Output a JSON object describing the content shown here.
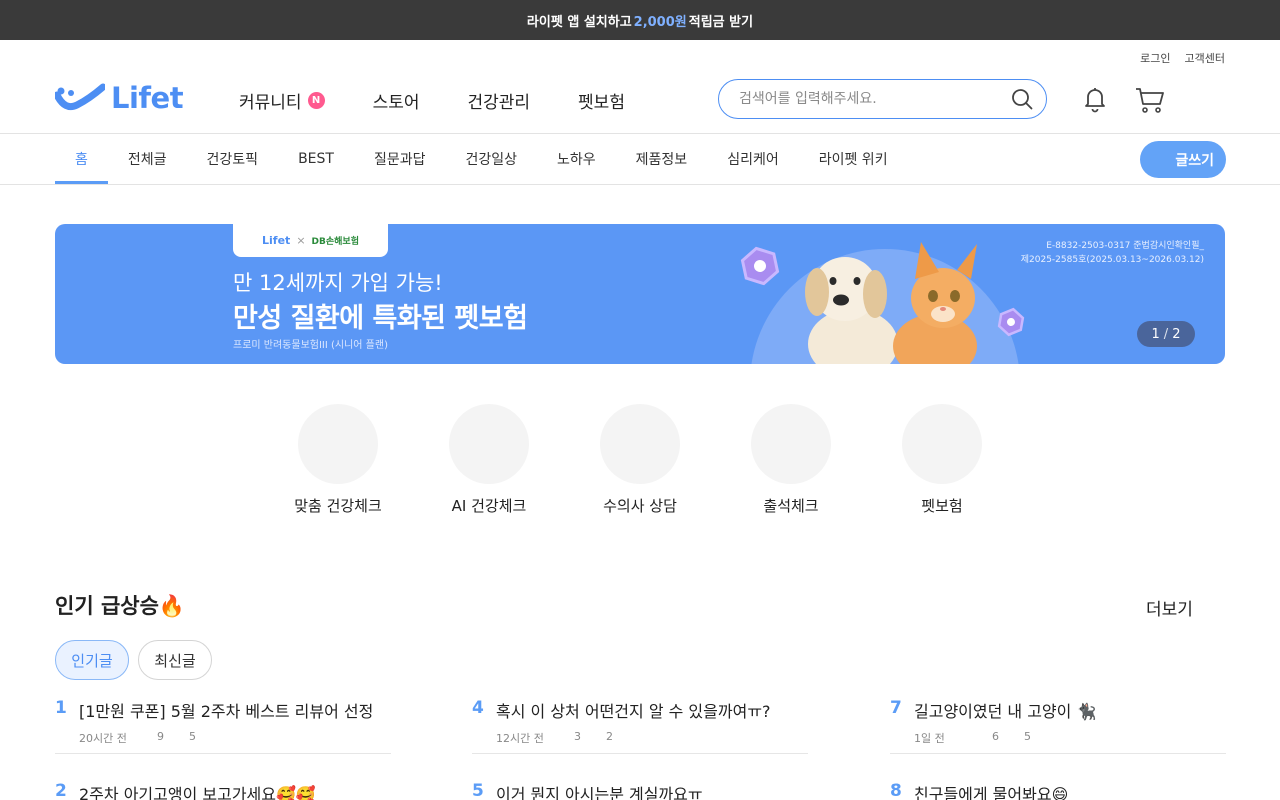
{
  "promo": {
    "prefix": "라이펫 앱 설치하고",
    "amount": "2,000원",
    "suffix": "적립금 받기"
  },
  "util": {
    "login": "로그인",
    "support": "고객센터"
  },
  "logo": {
    "text": "Lifet"
  },
  "gnb": [
    {
      "label": "커뮤니티",
      "badge": "N"
    },
    {
      "label": "스토어"
    },
    {
      "label": "건강관리"
    },
    {
      "label": "펫보험"
    }
  ],
  "search": {
    "placeholder": "검색어를 입력해주세요.",
    "value": ""
  },
  "subnav": [
    "홈",
    "전체글",
    "건강토픽",
    "BEST",
    "질문과답",
    "건강일상",
    "노하우",
    "제품정보",
    "심리케어",
    "라이펫 위키"
  ],
  "write_label": "글쓰기",
  "banner": {
    "chip_lifet": "Lifet",
    "chip_x": "×",
    "chip_partner": "DB손해보험",
    "subtitle": "만 12세까지 가입 가능!",
    "title": "만성 질환에 특화된 펫보험",
    "product": "프로미 반려동물보험III (시니어 플랜)",
    "legal_1": "E-8832-2503-0317 준법감시인확인필_",
    "legal_2": "제2025-2585호(2025.03.13~2026.03.12)",
    "pager_current": "1",
    "pager_sep": "/",
    "pager_total": "2"
  },
  "quick_menu": [
    "맞춤 건강체크",
    "AI 건강체크",
    "수의사 상담",
    "출석체크",
    "펫보험"
  ],
  "popular": {
    "title": "인기 급상승🔥",
    "more": "더보기",
    "tabs": [
      "인기글",
      "최신글"
    ],
    "posts": [
      {
        "rank": "1",
        "title": "[1만원 쿠폰] 5월 2주차 베스트 리뷰어 선정",
        "time": "20시간 전",
        "comments": "9",
        "likes": "5"
      },
      {
        "rank": "4",
        "title": "혹시 이 상처 어떤건지 알 수 있을까여ㅠ?",
        "time": "12시간 전",
        "comments": "3",
        "likes": "2"
      },
      {
        "rank": "7",
        "title": "길고양이였던 내 고양이 🐈‍⬛",
        "time": "1일 전",
        "comments": "6",
        "likes": "5"
      },
      {
        "rank": "2",
        "title": "2주차 아기고앵이 보고가세요🥰🥰",
        "time": "",
        "comments": "",
        "likes": ""
      },
      {
        "rank": "5",
        "title": "이거 뭔지 아시는분 계실까요ㅠ",
        "time": "",
        "comments": "",
        "likes": ""
      },
      {
        "rank": "8",
        "title": "친구들에게 물어봐요😄",
        "time": "",
        "comments": "",
        "likes": ""
      }
    ]
  },
  "colors": {
    "brand": "#4d8ef3",
    "badge": "#ff5a8f",
    "banner": "#5b97f5",
    "topbar": "#3a3a3a"
  }
}
